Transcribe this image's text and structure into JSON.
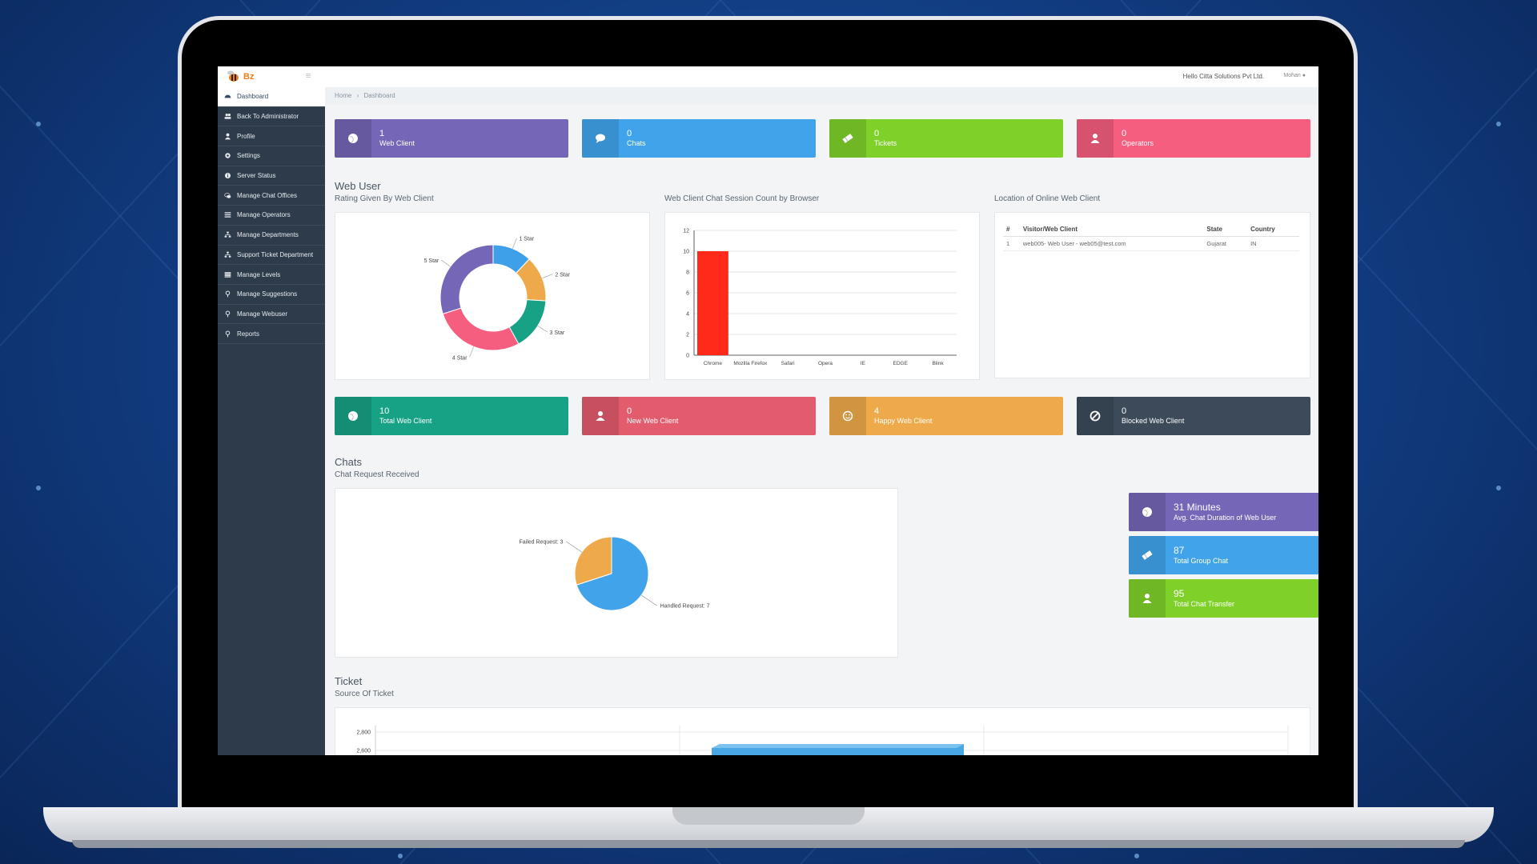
{
  "app": {
    "logo_text": "Bz",
    "company": "Hello Citta Solutions Pvt Ltd.",
    "user": "Mohan"
  },
  "sidebar": {
    "items": [
      {
        "label": "Dashboard",
        "icon": "dashboard-icon",
        "active": true
      },
      {
        "label": "Back To Administrator",
        "icon": "users-icon"
      },
      {
        "label": "Profile",
        "icon": "user-icon"
      },
      {
        "label": "Settings",
        "icon": "gear-icon"
      },
      {
        "label": "Server Status",
        "icon": "info-icon"
      },
      {
        "label": "Manage Chat Offices",
        "icon": "comments-icon"
      },
      {
        "label": "Manage Operators",
        "icon": "list-icon"
      },
      {
        "label": "Manage Departments",
        "icon": "sitemap-icon"
      },
      {
        "label": "Support Ticket Department",
        "icon": "sitemap-icon"
      },
      {
        "label": "Manage Levels",
        "icon": "levels-icon"
      },
      {
        "label": "Manage Suggestions",
        "icon": "pin-icon"
      },
      {
        "label": "Manage Webuser",
        "icon": "pin-icon"
      },
      {
        "label": "Reports",
        "icon": "pin-icon"
      }
    ]
  },
  "breadcrumb": {
    "home": "Home",
    "sep": "›",
    "current": "Dashboard"
  },
  "top_tiles": [
    {
      "value": "1",
      "label": "Web Client",
      "color": "#7566b7",
      "icon": "globe-icon"
    },
    {
      "value": "0",
      "label": "Chats",
      "color": "#41a4eb",
      "icon": "chat-icon"
    },
    {
      "value": "0",
      "label": "Tickets",
      "color": "#7fd12a",
      "icon": "ticket-icon"
    },
    {
      "value": "0",
      "label": "Operators",
      "color": "#f55e7f",
      "icon": "user-icon"
    }
  ],
  "web_user": {
    "title": "Web User",
    "rating_title": "Rating Given By Web Client",
    "browser_title": "Web Client Chat Session Count by Browser",
    "location_title": "Location of Online Web Client",
    "location_table": {
      "headers": [
        "#",
        "Visitor/Web Client",
        "State",
        "Country"
      ],
      "rows": [
        [
          "1",
          "web005- Web User - web05@test.com",
          "Gujarat",
          "IN"
        ]
      ]
    }
  },
  "mid_tiles": [
    {
      "value": "10",
      "label": "Total Web Client",
      "color": "#17a185",
      "icon": "globe-icon"
    },
    {
      "value": "0",
      "label": "New Web Client",
      "color": "#e25c6e",
      "icon": "user-icon"
    },
    {
      "value": "4",
      "label": "Happy Web Client",
      "color": "#eeaa4a",
      "icon": "smile-icon"
    },
    {
      "value": "0",
      "label": "Blocked Web Client",
      "color": "#3c4a59",
      "icon": "block-icon"
    }
  ],
  "chats": {
    "title": "Chats",
    "request_title": "Chat Request Received",
    "stats": [
      {
        "value": "31 Minutes",
        "label": "Avg. Chat Duration of Web User",
        "color": "#7566b7",
        "icon": "globe-icon"
      },
      {
        "value": "87",
        "label": "Total Group Chat",
        "color": "#41a4eb",
        "icon": "ticket-icon"
      },
      {
        "value": "95",
        "label": "Total Chat Transfer",
        "color": "#7fd12a",
        "icon": "user-icon"
      }
    ]
  },
  "ticket": {
    "title": "Ticket",
    "source_title": "Source Of Ticket"
  },
  "chart_data": [
    {
      "type": "pie",
      "variant": "donut",
      "title": "Rating Given By Web Client",
      "slices": [
        {
          "label": "1 Star",
          "value": 12,
          "color": "#3fa0ea"
        },
        {
          "label": "2 Star",
          "value": 14,
          "color": "#eeaa4a"
        },
        {
          "label": "3 Star",
          "value": 16,
          "color": "#17a185"
        },
        {
          "label": "4 Star",
          "value": 28,
          "color": "#f55e7f"
        },
        {
          "label": "5 Star",
          "value": 30,
          "color": "#7566b7"
        }
      ]
    },
    {
      "type": "bar",
      "title": "Web Client Chat Session Count by Browser",
      "categories": [
        "Chrome",
        "Mozilla Firefox",
        "Safari",
        "Opera",
        "IE",
        "EDGE",
        "Blink"
      ],
      "values": [
        10,
        0,
        0,
        0,
        0,
        0,
        0
      ],
      "color": "#ff2a1a",
      "ylim": [
        0,
        12
      ],
      "yticks": [
        0,
        2,
        4,
        6,
        8,
        10,
        12
      ],
      "grid": true
    },
    {
      "type": "pie",
      "title": "Chat Request Received",
      "slices": [
        {
          "label": "Failed Request: 3",
          "value": 3,
          "color": "#eeaa4a"
        },
        {
          "label": "Handled Request: 7",
          "value": 7,
          "color": "#41a4eb"
        }
      ]
    },
    {
      "type": "bar",
      "title": "Source Of Ticket",
      "yticks_visible": [
        "2,800",
        "2,600"
      ]
    }
  ]
}
